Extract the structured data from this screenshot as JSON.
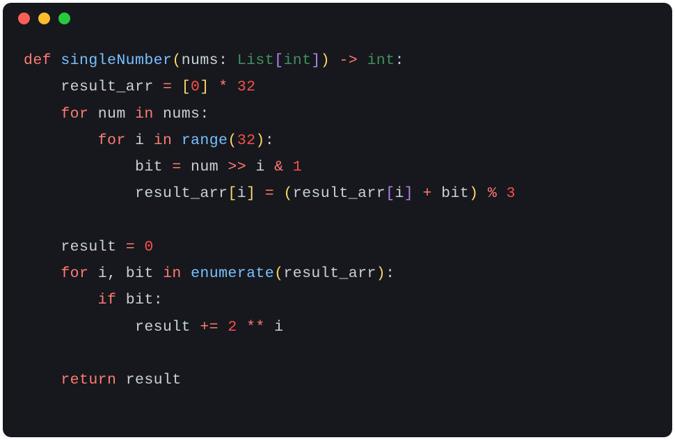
{
  "titlebar": {
    "red": "#ff5f56",
    "yellow": "#ffbd2e",
    "green": "#27c93f"
  },
  "tok": {
    "def": "def",
    "singleNumber": "singleNumber",
    "nums": "nums",
    "List": "List",
    "int": "int",
    "arrow": "->",
    "result_arr": "result_arr",
    "zero": "0",
    "thirtytwo": "32",
    "for": "for",
    "num": "num",
    "in": "in",
    "i": "i",
    "range": "range",
    "bit": "bit",
    "one": "1",
    "three": "3",
    "result": "result",
    "enumerate": "enumerate",
    "if": "if",
    "two": "2",
    "return": "return"
  }
}
